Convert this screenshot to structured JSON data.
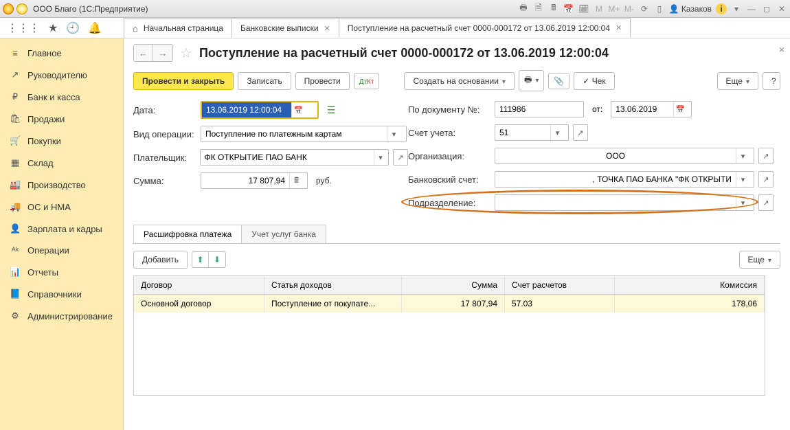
{
  "titlebar": {
    "title": "ООО Благо  (1С:Предприятие)",
    "user": "Казаков",
    "info_label": "i"
  },
  "tabs": {
    "home": "Начальная страница",
    "bank": "Банковские выписки",
    "doc": "Поступление на расчетный счет 0000-000172 от 13.06.2019 12:00:04"
  },
  "sidebar": {
    "items": [
      {
        "icon": "≡",
        "label": "Главное"
      },
      {
        "icon": "↗",
        "label": "Руководителю"
      },
      {
        "icon": "₽",
        "label": "Банк и касса"
      },
      {
        "icon": "🛍",
        "label": "Продажи"
      },
      {
        "icon": "🛒",
        "label": "Покупки"
      },
      {
        "icon": "▦",
        "label": "Склад"
      },
      {
        "icon": "🏭",
        "label": "Производство"
      },
      {
        "icon": "🚚",
        "label": "ОС и НМА"
      },
      {
        "icon": "👤",
        "label": "Зарплата и кадры"
      },
      {
        "icon": "ᴬᵏ",
        "label": "Операции"
      },
      {
        "icon": "📊",
        "label": "Отчеты"
      },
      {
        "icon": "📘",
        "label": "Справочники"
      },
      {
        "icon": "⚙",
        "label": "Администрирование"
      }
    ]
  },
  "page": {
    "title": "Поступление на расчетный счет 0000-000172 от 13.06.2019 12:00:04"
  },
  "actions": {
    "post_close": "Провести и закрыть",
    "save": "Записать",
    "post": "Провести",
    "dtkt": "Дᵀкᵀ",
    "create_based": "Создать на основании",
    "cheque": "Чек",
    "more": "Еще"
  },
  "form": {
    "date_label": "Дата:",
    "date_value": "13.06.2019 12:00:04",
    "op_type_label": "Вид операции:",
    "op_type_value": "Поступление по платежным картам",
    "payer_label": "Плательщик:",
    "payer_value": "ФК ОТКРЫТИЕ ПАО БАНК",
    "sum_label": "Сумма:",
    "sum_value": "17 807,94",
    "currency": "руб.",
    "docnum_label": "По документу №:",
    "docnum_value": "111986",
    "from_label": "от:",
    "from_value": "13.06.2019",
    "account_label": "Счет учета:",
    "account_value": "51",
    "org_label": "Организация:",
    "org_value": "ООО",
    "bank_acc_label": "Банковский счет:",
    "bank_acc_value": ", ТОЧКА ПАО БАНКА \"ФК ОТКРЫТИ",
    "division_label": "Подразделение:",
    "division_value": ""
  },
  "subtabs": {
    "t1": "Расшифровка платежа",
    "t2": "Учет услуг банка"
  },
  "subactions": {
    "add": "Добавить",
    "more": "Еще"
  },
  "table": {
    "headers": {
      "c1": "Договор",
      "c2": "Статья доходов",
      "c3": "Сумма",
      "c4": "Счет расчетов",
      "c5": "Комиссия"
    },
    "row": {
      "c1": "Основной договор",
      "c2": "Поступление от покупате...",
      "c3": "17 807,94",
      "c4": "57.03",
      "c5": "178,06"
    }
  }
}
